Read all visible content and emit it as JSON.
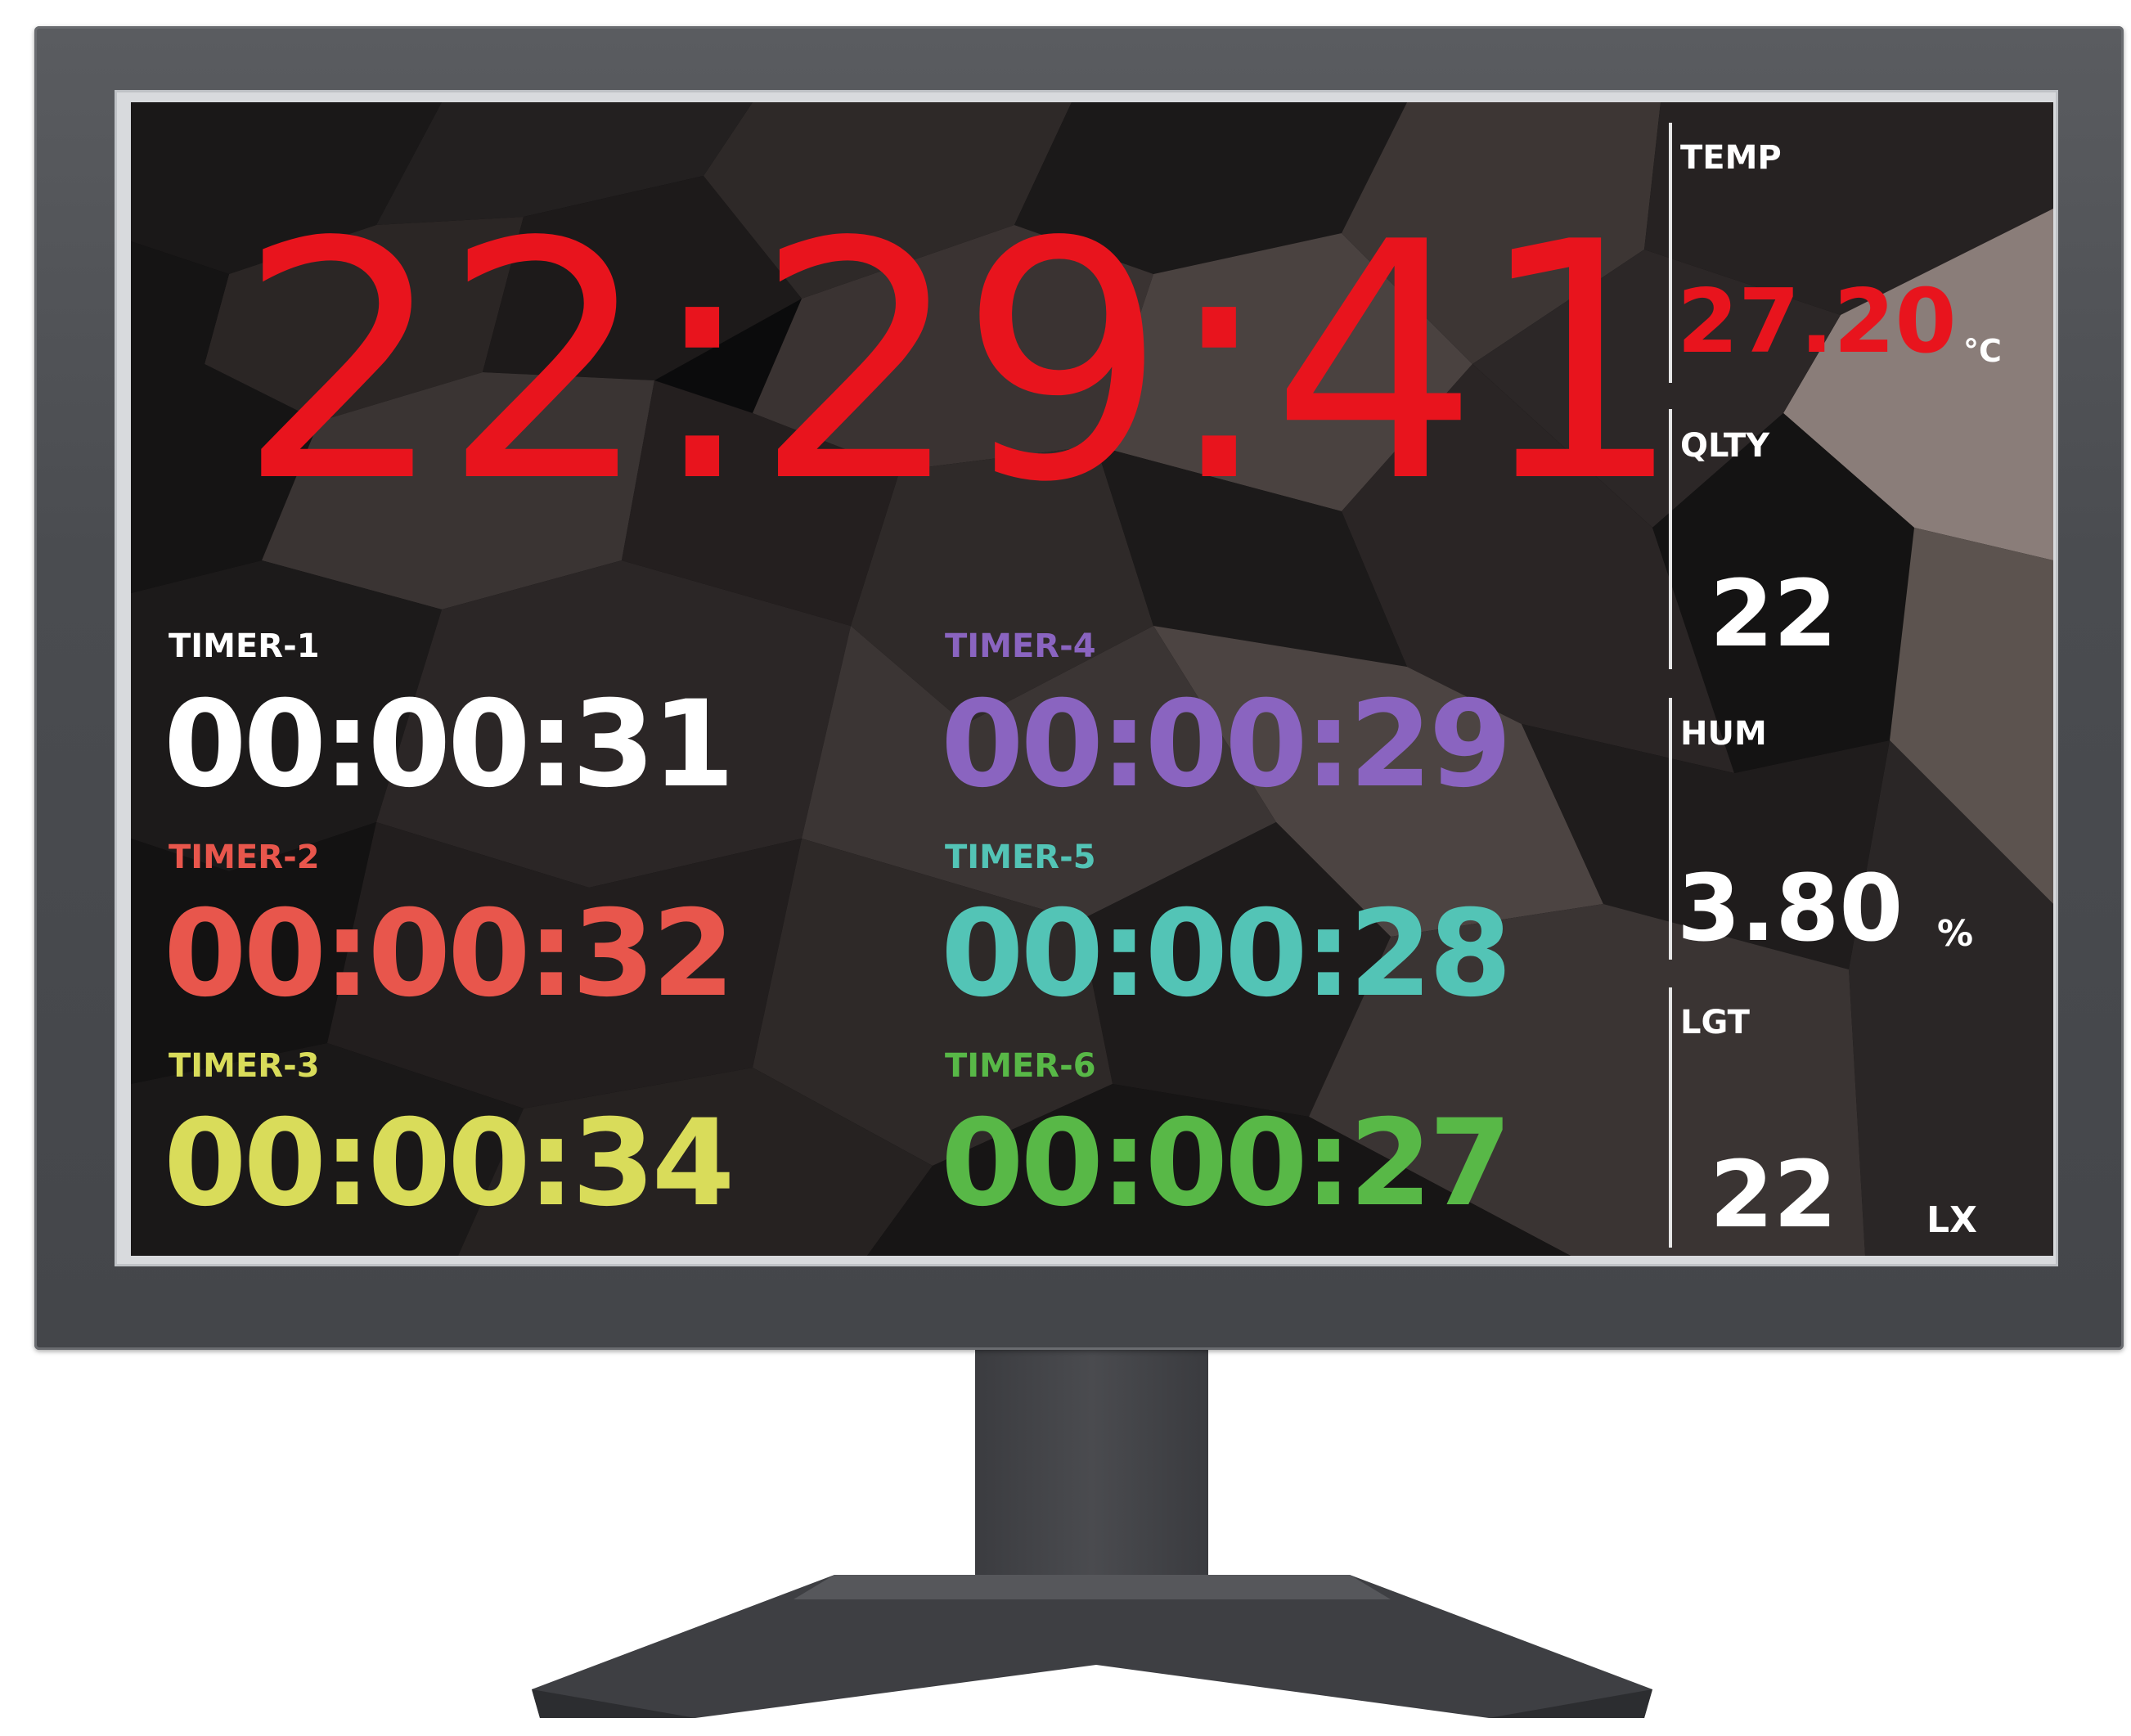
{
  "clock": {
    "time": "22:29:41",
    "color": "#e8141d"
  },
  "timers": [
    {
      "label": "TIMER-1",
      "value": "00:00:31",
      "color": "#ffffff"
    },
    {
      "label": "TIMER-2",
      "value": "00:00:32",
      "color": "#e8564c"
    },
    {
      "label": "TIMER-3",
      "value": "00:00:34",
      "color": "#d9dc5a"
    },
    {
      "label": "TIMER-4",
      "value": "00:00:29",
      "color": "#8a64c0"
    },
    {
      "label": "TIMER-5",
      "value": "00:00:28",
      "color": "#53c4b6"
    },
    {
      "label": "TIMER-6",
      "value": "00:00:27",
      "color": "#58b847"
    }
  ],
  "sensors": {
    "temp": {
      "label": "TEMP",
      "value": "27.20",
      "unit": "°C",
      "color": "#e8141d"
    },
    "qlty": {
      "label": "QLTY",
      "value": "22",
      "unit": "",
      "color": "#ffffff"
    },
    "hum": {
      "label": "HUM",
      "value": "3.80",
      "unit": "%",
      "color": "#ffffff"
    },
    "lgt": {
      "label": "LGT",
      "value": "22",
      "unit": "LX",
      "color": "#ffffff"
    }
  }
}
